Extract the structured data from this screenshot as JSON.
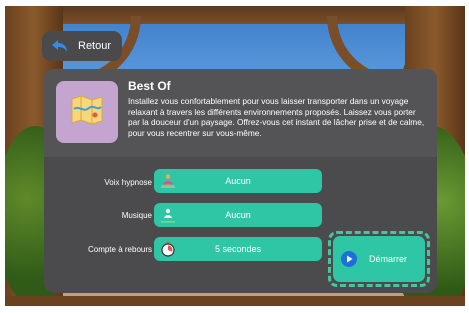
{
  "back": {
    "label": "Retour",
    "icon": "back-arrow-icon"
  },
  "session": {
    "title": "Best Of",
    "description": "Installez vous confortablement pour vous laisser transporter dans un voyage relaxant à travers les différents environnements proposés. Laissez vous porter par la douceur d'un paysage. Offrez-vous cet instant de lâcher prise et de calme, pour vous recentrer sur vous-même.",
    "thumbnail_icon": "map-icon"
  },
  "options": [
    {
      "label": "Voix hypnose",
      "value": "Aucun",
      "icon": "meditation-icon"
    },
    {
      "label": "Musique",
      "value": "Aucun",
      "icon": "music-meditation-icon"
    },
    {
      "label": "Compte à rebours",
      "value": "5 secondes",
      "icon": "stopwatch-icon"
    }
  ],
  "start": {
    "label": "Démarrer",
    "icon": "play-icon"
  },
  "colors": {
    "accent": "#2fc6a6",
    "panel": "#4b4b4d",
    "play": "#1e6fd8",
    "focus": "#46c69a"
  }
}
